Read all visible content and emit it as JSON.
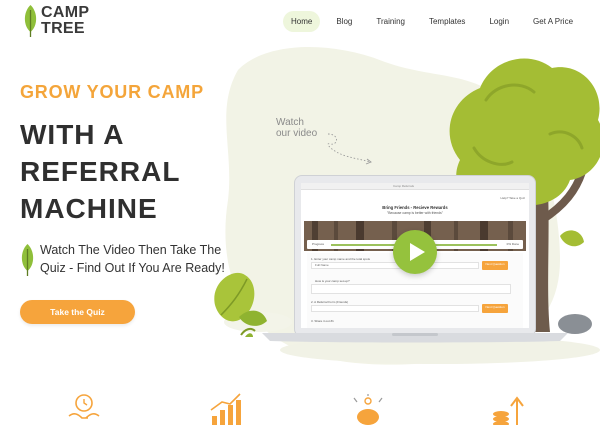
{
  "brand": {
    "line1": "CAMP",
    "line2": "TREE"
  },
  "nav": {
    "items": [
      {
        "label": "Home",
        "active": true
      },
      {
        "label": "Blog",
        "active": false
      },
      {
        "label": "Training",
        "active": false
      },
      {
        "label": "Templates",
        "active": false
      },
      {
        "label": "Login",
        "active": false
      },
      {
        "label": "Get A Price",
        "active": false
      }
    ]
  },
  "hero": {
    "eyebrow": "GROW YOUR CAMP",
    "headline": [
      "WITH A",
      "REFERRAL",
      "MACHINE"
    ],
    "subtext": [
      "Watch The Video Then Take The",
      "Quiz - Find Out If You Are Ready!"
    ],
    "cta_label": "Take the Quiz",
    "watch_lines": [
      "Watch",
      "our video"
    ]
  },
  "screen": {
    "browser_title": "Camp Referrals",
    "corner_text": "Help? Take a Quiz",
    "heading": "Bring Friends - Recieve Rewards",
    "subheading": "\"Because camp is better with friends\"",
    "progress_label": "Progress",
    "progress_pct": "0% Done",
    "q1_label": "1. Enter your camp name and the total spots",
    "q1_value": "Full Name",
    "q1_button": "Next Question",
    "q2_label": "How is your camp set-up?",
    "q3_label": "2. A Referral Form (Friends)",
    "q3_button": "Next Question",
    "q4_label": "3. Share it out #1"
  },
  "colors": {
    "accent_orange": "#f6a43c",
    "leaf_green": "#8fbf3a",
    "play_green": "#95c23d",
    "text_dark": "#2f2f2f",
    "blob_cream": "#f2f3e6"
  },
  "features": {
    "icons": [
      "hand-clock-icon",
      "growth-chart-icon",
      "piggy-bank-icon",
      "coins-growth-icon"
    ]
  }
}
